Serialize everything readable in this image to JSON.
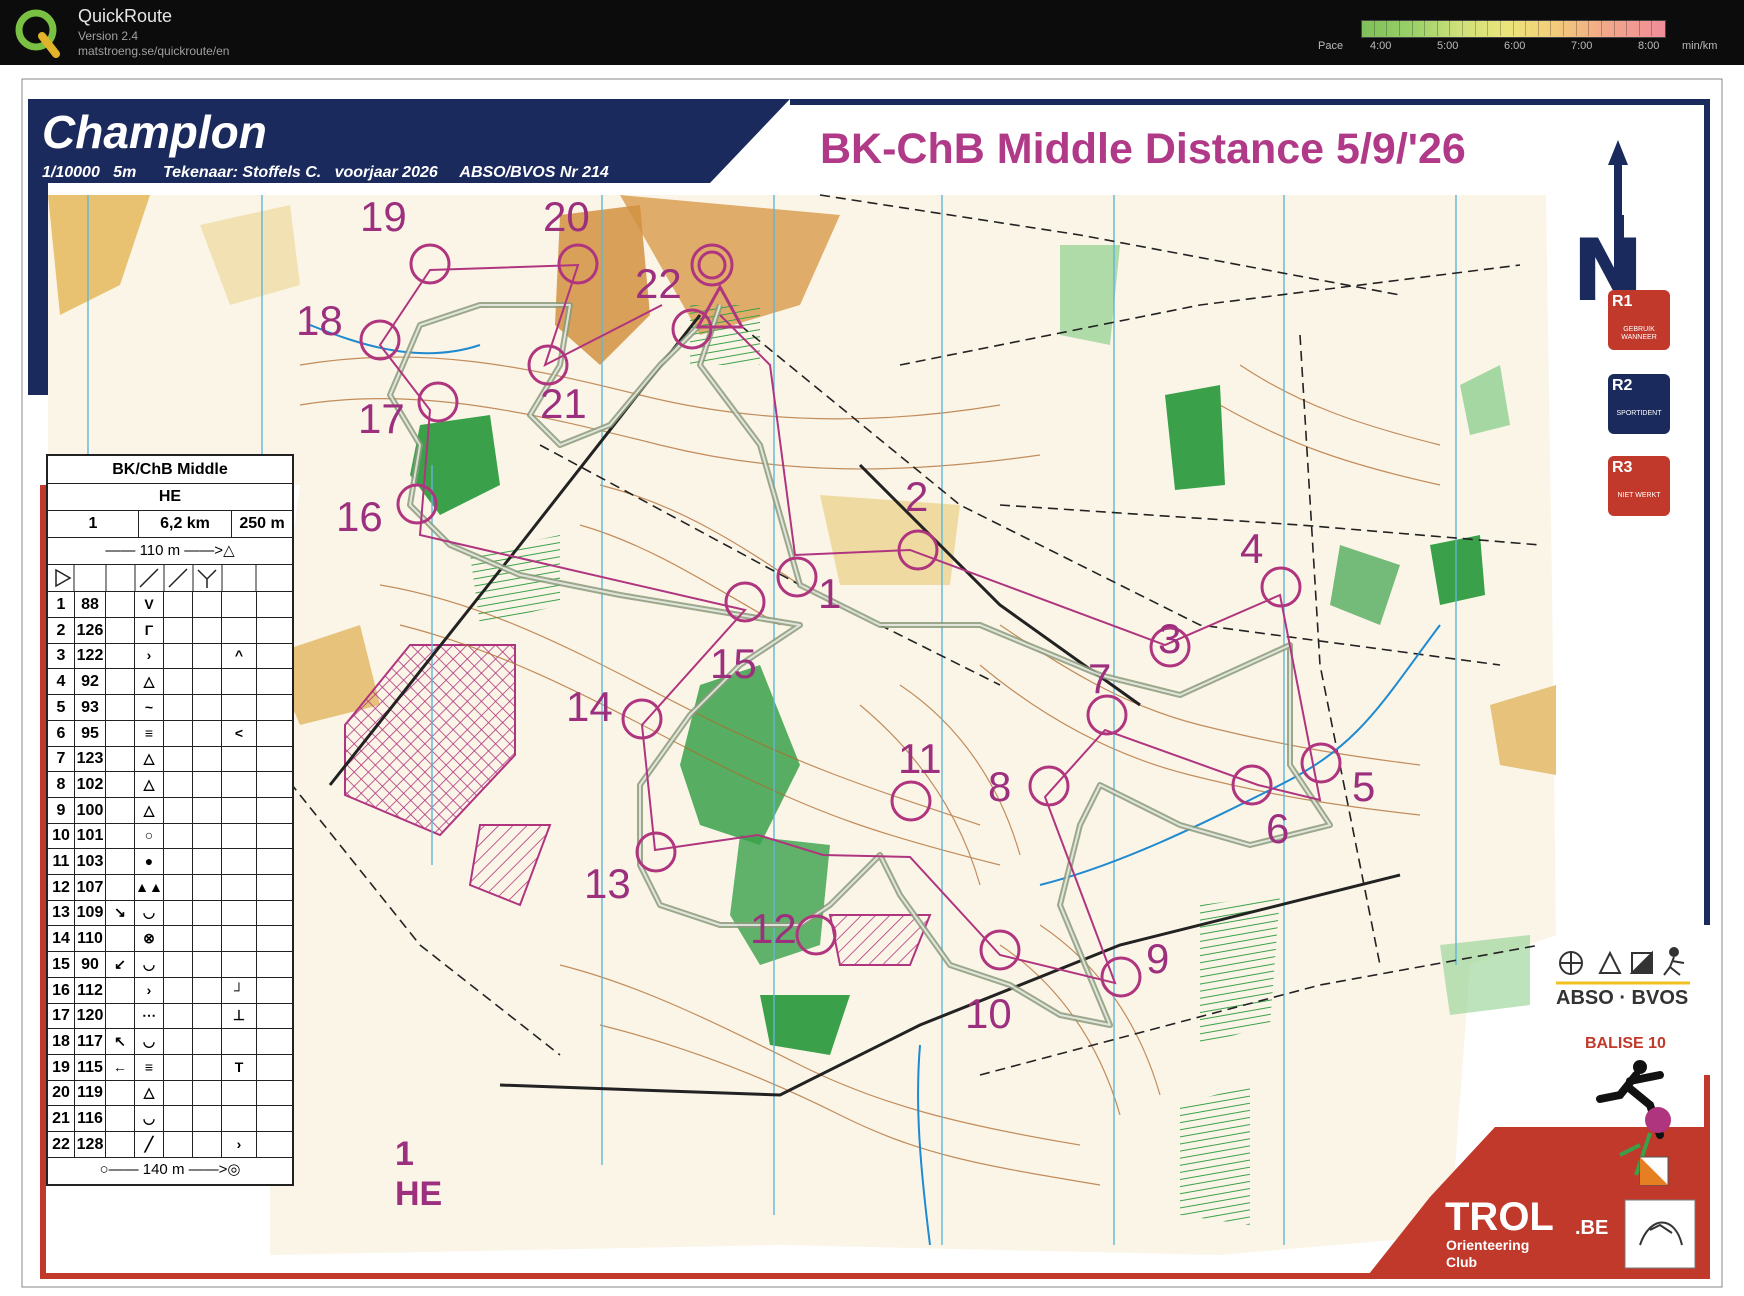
{
  "app": {
    "name": "QuickRoute",
    "version": "Version 2.4",
    "url": "matstroeng.se/quickroute/en"
  },
  "pace_scale": {
    "label": "Pace",
    "ticks": [
      "4:00",
      "5:00",
      "6:00",
      "7:00",
      "8:00"
    ],
    "unit": "min/km",
    "colors": [
      "#7fbf5a",
      "#cfe07a",
      "#ece57b",
      "#f2a98a",
      "#f08c9a"
    ]
  },
  "map": {
    "title": "Champlon",
    "info": "1/10000   5m      Tekenaar: Stoffels C.   voorjaar 2026     ABSO/BVOS Nr 214",
    "event_title": "BK-ChB Middle Distance 5/9/'26",
    "course_number": "1",
    "course_class": "HE",
    "colors": {
      "course": "#b0357f",
      "route": "#8a9a7a",
      "frame_blue": "#1b2a5c",
      "frame_red": "#c0392b"
    }
  },
  "legend_badges": [
    {
      "code": "R1",
      "desc": "GEBRUIK WANNEER",
      "color": "#c0392b"
    },
    {
      "code": "R2",
      "desc": "SPORTIDENT",
      "color": "#1b2a5c"
    },
    {
      "code": "R3",
      "desc": "NIET WERKT",
      "color": "#c0392b"
    }
  ],
  "control_numbers": [
    "1",
    "2",
    "3",
    "4",
    "5",
    "6",
    "7",
    "8",
    "9",
    "10",
    "11",
    "12",
    "13",
    "14",
    "15",
    "16",
    "17",
    "18",
    "19",
    "20",
    "21",
    "22"
  ],
  "description_sheet": {
    "title": "BK/ChB Middle",
    "class": "HE",
    "course": "1",
    "length": "6,2 km",
    "climb": "250 m",
    "start_line": "110 m",
    "finish_line": "140 m",
    "controls": [
      {
        "seq": "1",
        "code": "88",
        "dir": "",
        "feat": "V",
        "extra": ""
      },
      {
        "seq": "2",
        "code": "126",
        "dir": "",
        "feat": "Γ",
        "extra": ""
      },
      {
        "seq": "3",
        "code": "122",
        "dir": "",
        "feat": "›",
        "extra": "^"
      },
      {
        "seq": "4",
        "code": "92",
        "dir": "",
        "feat": "△",
        "extra": ""
      },
      {
        "seq": "5",
        "code": "93",
        "dir": "",
        "feat": "~",
        "extra": ""
      },
      {
        "seq": "6",
        "code": "95",
        "dir": "",
        "feat": "≡",
        "extra": "<"
      },
      {
        "seq": "7",
        "code": "123",
        "dir": "",
        "feat": "△",
        "extra": ""
      },
      {
        "seq": "8",
        "code": "102",
        "dir": "",
        "feat": "△",
        "extra": ""
      },
      {
        "seq": "9",
        "code": "100",
        "dir": "",
        "feat": "△",
        "extra": ""
      },
      {
        "seq": "10",
        "code": "101",
        "dir": "",
        "feat": "○",
        "extra": ""
      },
      {
        "seq": "11",
        "code": "103",
        "dir": "",
        "feat": "●",
        "extra": ""
      },
      {
        "seq": "12",
        "code": "107",
        "dir": "",
        "feat": "▲▲",
        "extra": ""
      },
      {
        "seq": "13",
        "code": "109",
        "dir": "↘",
        "feat": "◡",
        "extra": ""
      },
      {
        "seq": "14",
        "code": "110",
        "dir": "",
        "feat": "⊗",
        "extra": ""
      },
      {
        "seq": "15",
        "code": "90",
        "dir": "↙",
        "feat": "◡",
        "extra": ""
      },
      {
        "seq": "16",
        "code": "112",
        "dir": "",
        "feat": "›",
        "extra": "┘"
      },
      {
        "seq": "17",
        "code": "120",
        "dir": "",
        "feat": "⋯",
        "extra": "⊥"
      },
      {
        "seq": "18",
        "code": "117",
        "dir": "↖",
        "feat": "◡",
        "extra": ""
      },
      {
        "seq": "19",
        "code": "115",
        "dir": "←",
        "feat": "≡",
        "extra": "T"
      },
      {
        "seq": "20",
        "code": "119",
        "dir": "",
        "feat": "△",
        "extra": ""
      },
      {
        "seq": "21",
        "code": "116",
        "dir": "",
        "feat": "◡",
        "extra": ""
      },
      {
        "seq": "22",
        "code": "128",
        "dir": "",
        "feat": "╱",
        "extra": "›"
      }
    ]
  },
  "logos": {
    "abso": "ABSO · BVOS",
    "balise": "BALISE 10",
    "trol": "TROL",
    "trol_suffix": ".BE",
    "trol_sub": "Orienteering\nClub"
  }
}
